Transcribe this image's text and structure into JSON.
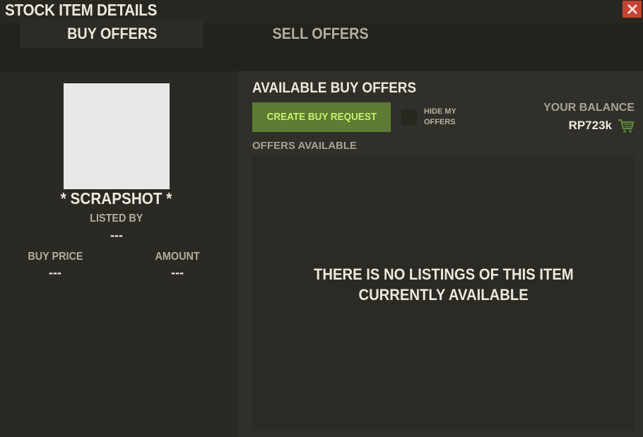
{
  "window": {
    "title": "STOCK ITEM DETAILS",
    "close_icon": "close-x-icon",
    "close_color": "#c44232"
  },
  "tabs": [
    {
      "label": "BUY OFFERS",
      "active": true
    },
    {
      "label": "SELL OFFERS",
      "active": false
    }
  ],
  "item": {
    "name": "* SCRAPSHOT *",
    "listed_by_label": "LISTED BY",
    "listed_by_value": "---",
    "buy_price_label": "BUY PRICE",
    "buy_price_value": "---",
    "amount_label": "AMOUNT",
    "amount_value": "---"
  },
  "buy_offers": {
    "title": "AVAILABLE BUY OFFERS",
    "create_button_label": "CREATE BUY REQUEST",
    "create_button_color": "#5b7c32",
    "hide_my_offers_label": "HIDE MY OFFERS",
    "hide_my_offers_checked": false,
    "balance_label": "YOUR BALANCE",
    "balance_value": "RP723k",
    "balance_icon": "shopping-cart-icon",
    "offers_available_label": "OFFERS AVAILABLE",
    "empty_line1": "THERE IS NO LISTINGS OF THIS ITEM",
    "empty_line2": "CURRENTLY AVAILABLE"
  }
}
